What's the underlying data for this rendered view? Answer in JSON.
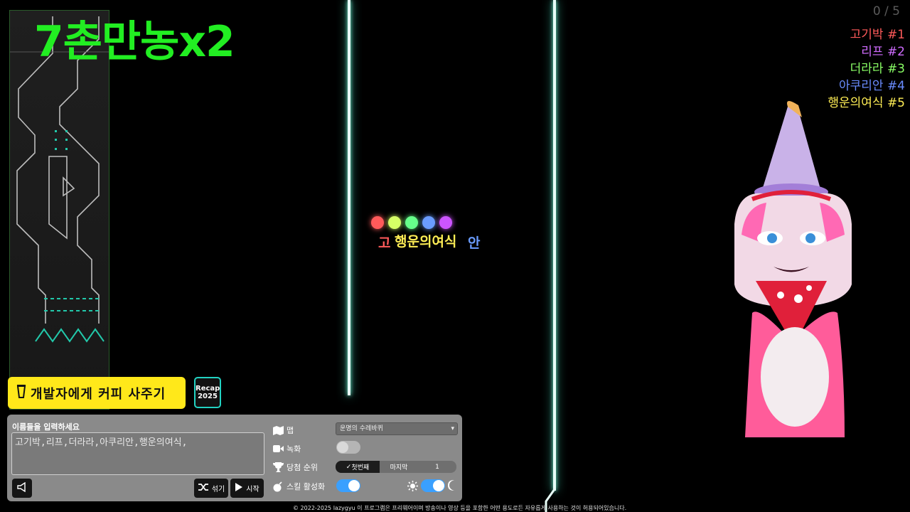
{
  "title": "7촌만농x2",
  "finish_counter": "0 / 5",
  "ranking": [
    {
      "name": "고기박",
      "rank": "#1",
      "color": "#ff5a5a"
    },
    {
      "name": "리프",
      "rank": "#2",
      "color": "#d06cff"
    },
    {
      "name": "더라라",
      "rank": "#3",
      "color": "#8aff66"
    },
    {
      "name": "아쿠리안",
      "rank": "#4",
      "color": "#6a8cff"
    },
    {
      "name": "행운의여식",
      "rank": "#5",
      "color": "#ffee55"
    }
  ],
  "marbles": [
    {
      "color": "#ff5a5a"
    },
    {
      "color": "#d6ff66"
    },
    {
      "color": "#66ff8a"
    },
    {
      "color": "#6a9cff"
    },
    {
      "color": "#cc55ff"
    }
  ],
  "marble_labels": {
    "front": "행운의여식",
    "left_fragment": "고",
    "right_fragment": "안"
  },
  "coffee_button": "개발자에게 커피 사주기",
  "recap_button": {
    "line1": "Recap",
    "line2": "2025"
  },
  "panel": {
    "name_label": "이름들을 입력하세요",
    "name_value": "고기박,리프,더라라,아쿠리안,행운의여식,",
    "shuffle_label": "섞기",
    "start_label": "시작",
    "map_label": "맵",
    "map_value": "운명의 수레바퀴",
    "record_label": "녹화",
    "record_on": false,
    "winner_rank_label": "당첨 순위",
    "first_option": "첫번째",
    "last_option": "마지막",
    "rank_number": "1",
    "skill_label": "스킬 활성화",
    "skill_on": true,
    "theme_dark": true,
    "accent_color": "#3aa0ff"
  },
  "footer": "© 2022-2025 lazygyu 이 프로그램은 프리웨어이며 방송이나 영상 등을 포함한 어떤 용도로든 자유롭게 사용하는 것이 허용되어있습니다."
}
